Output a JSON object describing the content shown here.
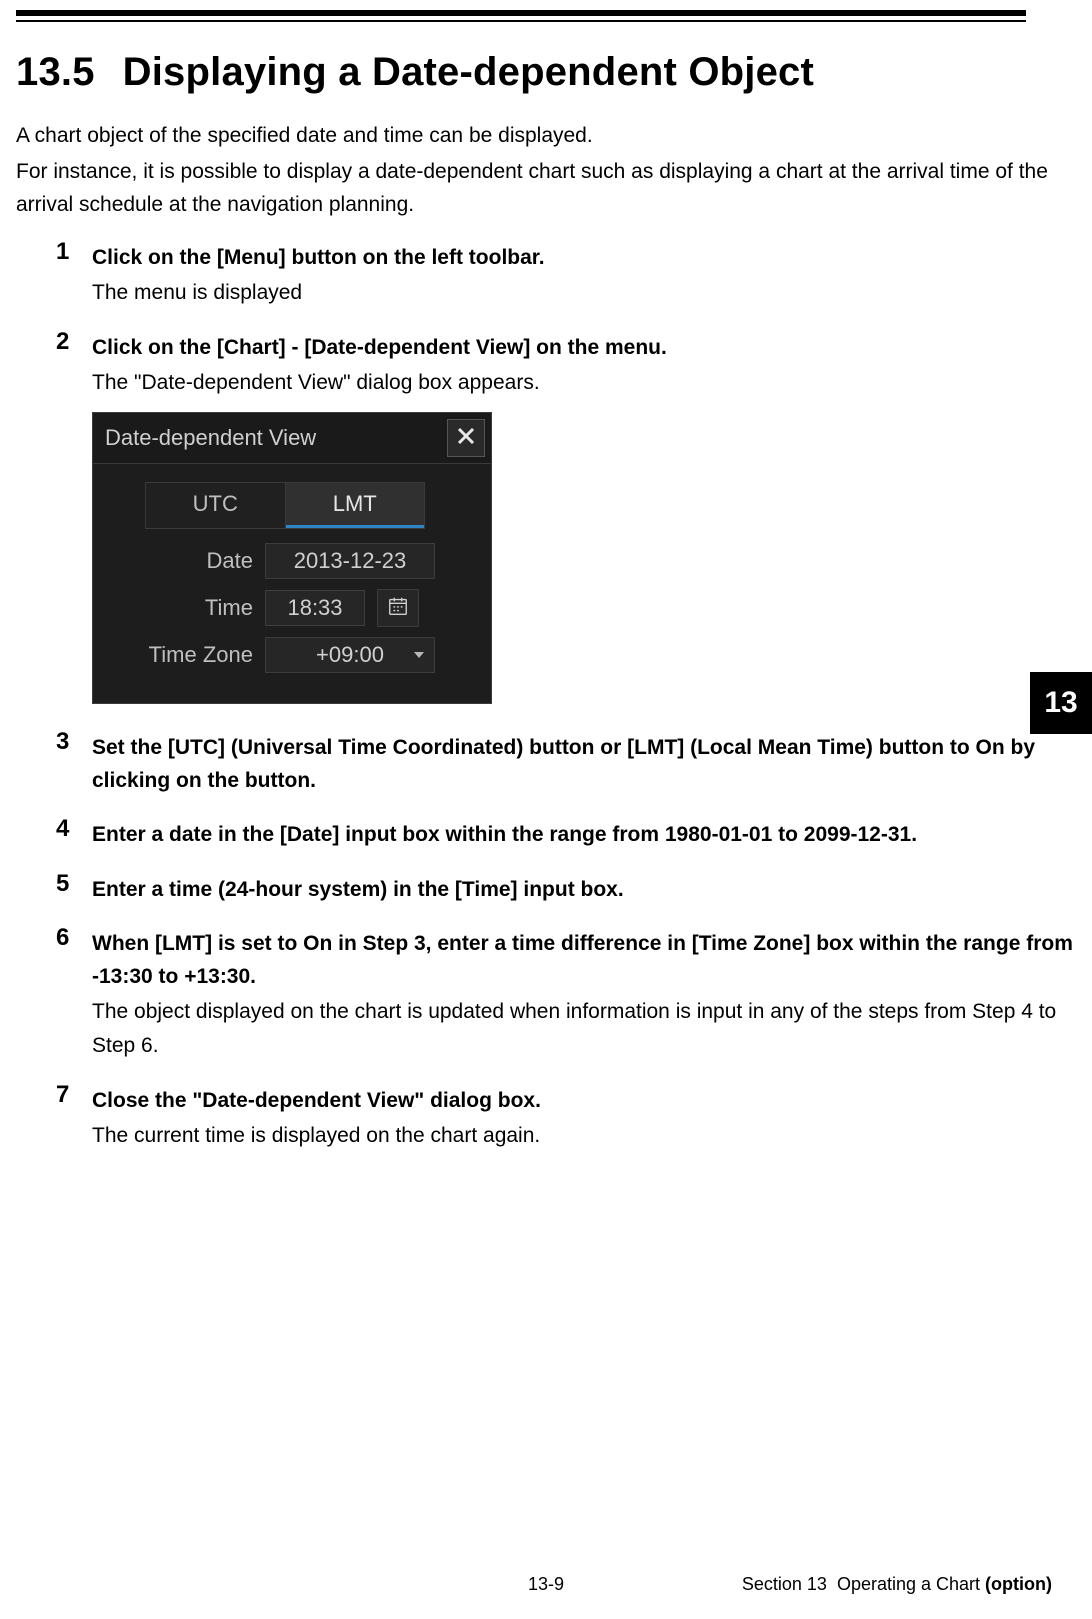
{
  "title": {
    "number": "13.5",
    "text": "Displaying a Date-dependent Object"
  },
  "intro": {
    "p1": "A chart object of the specified date and time can be displayed.",
    "p2": "For instance, it is possible to display a date-dependent chart such as displaying a chart at the arrival time of the arrival schedule at the navigation planning."
  },
  "steps": [
    {
      "n": "1",
      "title": "Click on the [Menu] button on the left toolbar.",
      "body": "The menu is displayed"
    },
    {
      "n": "2",
      "title": "Click on the [Chart] - [Date-dependent View] on the menu.",
      "body": "The \"Date-dependent View\" dialog box appears."
    },
    {
      "n": "3",
      "title": "Set the [UTC] (Universal Time Coordinated) button or [LMT] (Local Mean Time) button to On by clicking on the button.",
      "body": ""
    },
    {
      "n": "4",
      "title": "Enter a date in the [Date] input box within the range from 1980-01-01 to 2099-12-31.",
      "body": ""
    },
    {
      "n": "5",
      "title": "Enter a time (24-hour system) in the [Time] input box.",
      "body": ""
    },
    {
      "n": "6",
      "title": "When [LMT] is set to On in Step 3, enter a time difference in [Time Zone] box within the range from -13:30 to +13:30.",
      "body": "The object displayed on the chart is updated when information is input in any of the steps from Step 4 to Step 6."
    },
    {
      "n": "7",
      "title": "Close the \"Date-dependent View\" dialog box.",
      "body": "The current time is displayed on the chart again."
    }
  ],
  "dialog": {
    "title": "Date-dependent View",
    "tabs": {
      "utc": "UTC",
      "lmt": "LMT",
      "active": "lmt"
    },
    "labels": {
      "date": "Date",
      "time": "Time",
      "timezone": "Time Zone"
    },
    "values": {
      "date": "2013-12-23",
      "time": "18:33",
      "timezone": "+09:00"
    }
  },
  "chapterTab": "13",
  "footer": {
    "page": "13-9",
    "section_prefix": "Section 13",
    "section_text": "Operating a Chart",
    "section_bold": "(option)"
  }
}
